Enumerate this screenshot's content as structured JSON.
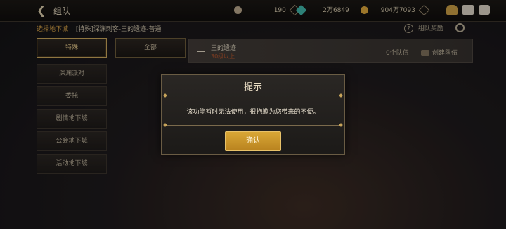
{
  "header": {
    "title": "组队",
    "currencies": [
      {
        "icon": "coin-icon",
        "value": "190",
        "color": "#b8a58b"
      },
      {
        "icon": "gem-icon",
        "value": "2万6849",
        "color": "#3fb3a7"
      },
      {
        "icon": "gold-icon",
        "value": "904万7093",
        "color": "#d8a43b"
      }
    ],
    "icons": [
      "cake-icon",
      "mail-icon",
      "chat-icon"
    ]
  },
  "breadcrumb": {
    "label": "选择地下城",
    "path": "[特殊]深渊刺客-王的遗迹-普通"
  },
  "team_reward": "组队奖励",
  "tabs": [
    {
      "label": "特殊",
      "active": true
    },
    {
      "label": "全部",
      "active": false
    }
  ],
  "sidebar": {
    "items": [
      {
        "label": "深渊派对"
      },
      {
        "label": "委托"
      },
      {
        "label": "剧情地下城"
      },
      {
        "label": "公会地下城"
      },
      {
        "label": "活动地下城"
      }
    ]
  },
  "dungeon": {
    "name": "王的遗迹",
    "level": "30级以上",
    "team_count": "0个队伍",
    "create_label": "创建队伍"
  },
  "dialog": {
    "title": "提示",
    "message": "该功能暂时无法使用，很抱歉为您带来的不便。",
    "confirm_label": "确认"
  }
}
